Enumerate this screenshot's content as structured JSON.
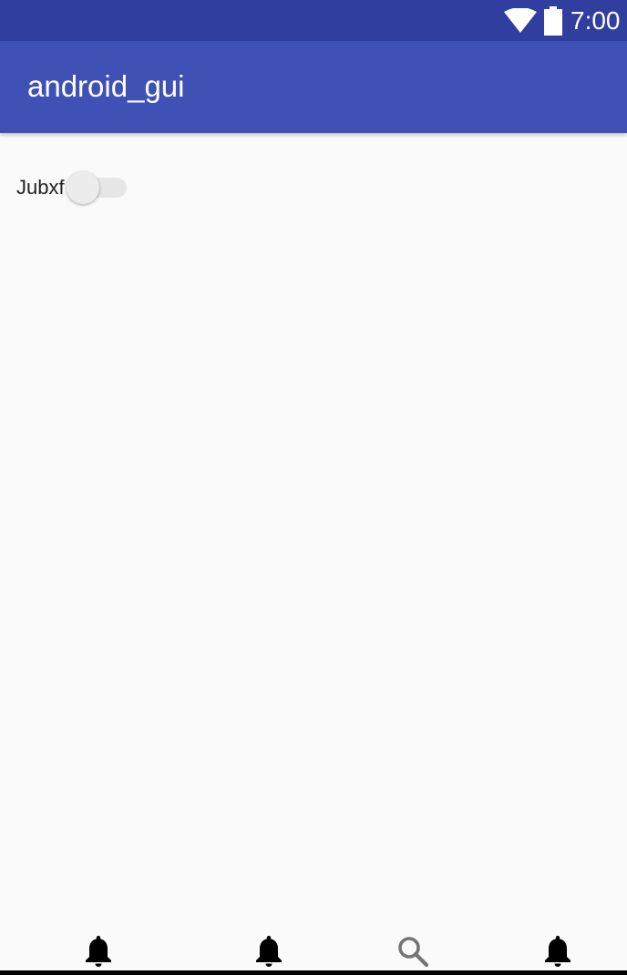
{
  "status_bar": {
    "time": "7:00",
    "wifi_icon": "wifi-icon",
    "battery_icon": "battery-icon",
    "background_color": "#303f9f"
  },
  "app_bar": {
    "title": "android_gui",
    "background_color": "#3f51b5"
  },
  "content": {
    "switch": {
      "label": "Jubxf",
      "checked": false
    }
  },
  "bottom_nav": {
    "items": [
      {
        "icon": "bell-icon"
      },
      {
        "icon": "bell-icon"
      },
      {
        "icon": "search-icon"
      },
      {
        "icon": "bell-icon"
      }
    ]
  }
}
